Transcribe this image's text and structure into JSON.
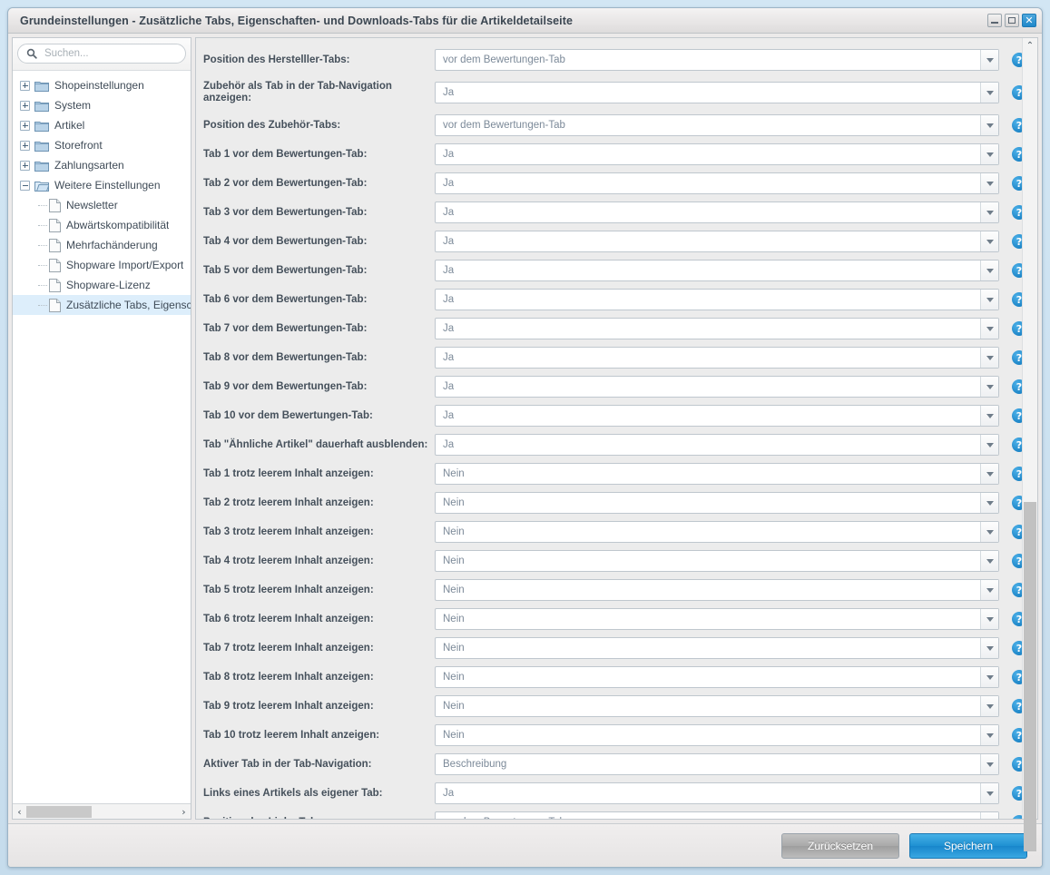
{
  "window": {
    "title": "Grundeinstellungen - Zusätzliche Tabs, Eigenschaften- und Downloads-Tabs für die Artikeldetailseite",
    "minimize_label": "",
    "maximize_label": "",
    "close_label": "✕"
  },
  "search": {
    "placeholder": "Suchen...",
    "value": "",
    "icon": "search-icon"
  },
  "tree": {
    "items": [
      {
        "label": "Shopeinstellungen",
        "type": "folder",
        "expanded": false,
        "selected": false,
        "depth": 0
      },
      {
        "label": "System",
        "type": "folder",
        "expanded": false,
        "selected": false,
        "depth": 0
      },
      {
        "label": "Artikel",
        "type": "folder",
        "expanded": false,
        "selected": false,
        "depth": 0
      },
      {
        "label": "Storefront",
        "type": "folder",
        "expanded": false,
        "selected": false,
        "depth": 0
      },
      {
        "label": "Zahlungsarten",
        "type": "folder",
        "expanded": false,
        "selected": false,
        "depth": 0
      },
      {
        "label": "Weitere Einstellungen",
        "type": "folder",
        "expanded": true,
        "selected": false,
        "depth": 0
      },
      {
        "label": "Newsletter",
        "type": "doc",
        "selected": false,
        "depth": 1
      },
      {
        "label": "Abwärtskompatibilität",
        "type": "doc",
        "selected": false,
        "depth": 1
      },
      {
        "label": "Mehrfachänderung",
        "type": "doc",
        "selected": false,
        "depth": 1
      },
      {
        "label": "Shopware Import/Export",
        "type": "doc",
        "selected": false,
        "depth": 1
      },
      {
        "label": "Shopware-Lizenz",
        "type": "doc",
        "selected": false,
        "depth": 1
      },
      {
        "label": "Zusätzliche Tabs, Eigenschaften",
        "type": "doc",
        "selected": true,
        "depth": 1
      }
    ],
    "hscroll": {
      "left_arrow": "‹",
      "right_arrow": "›"
    }
  },
  "form": {
    "help_icon_label": "?",
    "rows": [
      {
        "label": "Position des Herstelller-Tabs:",
        "value": "vor dem Bewertungen-Tab",
        "tall": false
      },
      {
        "label": "Zubehör als Tab in der Tab-Navigation anzeigen:",
        "value": "Ja",
        "tall": true
      },
      {
        "label": "Position des Zubehör-Tabs:",
        "value": "vor dem Bewertungen-Tab",
        "tall": false
      },
      {
        "label": "Tab 1 vor dem Bewertungen-Tab:",
        "value": "Ja",
        "tall": false
      },
      {
        "label": "Tab 2 vor dem Bewertungen-Tab:",
        "value": "Ja",
        "tall": false
      },
      {
        "label": "Tab 3 vor dem Bewertungen-Tab:",
        "value": "Ja",
        "tall": false
      },
      {
        "label": "Tab 4 vor dem Bewertungen-Tab:",
        "value": "Ja",
        "tall": false
      },
      {
        "label": "Tab 5 vor dem Bewertungen-Tab:",
        "value": "Ja",
        "tall": false
      },
      {
        "label": "Tab 6 vor dem Bewertungen-Tab:",
        "value": "Ja",
        "tall": false
      },
      {
        "label": "Tab 7 vor dem Bewertungen-Tab:",
        "value": "Ja",
        "tall": false
      },
      {
        "label": "Tab 8 vor dem Bewertungen-Tab:",
        "value": "Ja",
        "tall": false
      },
      {
        "label": "Tab 9 vor dem Bewertungen-Tab:",
        "value": "Ja",
        "tall": false
      },
      {
        "label": "Tab 10 vor dem Bewertungen-Tab:",
        "value": "Ja",
        "tall": false
      },
      {
        "label": "Tab \"Ähnliche Artikel\" dauerhaft ausblenden:",
        "value": "Ja",
        "tall": false
      },
      {
        "label": "Tab 1 trotz leerem Inhalt anzeigen:",
        "value": "Nein",
        "tall": false
      },
      {
        "label": "Tab 2 trotz leerem Inhalt anzeigen:",
        "value": "Nein",
        "tall": false
      },
      {
        "label": "Tab 3 trotz leerem Inhalt anzeigen:",
        "value": "Nein",
        "tall": false
      },
      {
        "label": "Tab 4 trotz leerem Inhalt anzeigen:",
        "value": "Nein",
        "tall": false
      },
      {
        "label": "Tab 5 trotz leerem Inhalt anzeigen:",
        "value": "Nein",
        "tall": false
      },
      {
        "label": "Tab 6 trotz leerem Inhalt anzeigen:",
        "value": "Nein",
        "tall": false
      },
      {
        "label": "Tab 7 trotz leerem Inhalt anzeigen:",
        "value": "Nein",
        "tall": false
      },
      {
        "label": "Tab 8 trotz leerem Inhalt anzeigen:",
        "value": "Nein",
        "tall": false
      },
      {
        "label": "Tab 9 trotz leerem Inhalt anzeigen:",
        "value": "Nein",
        "tall": false
      },
      {
        "label": "Tab 10 trotz leerem Inhalt anzeigen:",
        "value": "Nein",
        "tall": false
      },
      {
        "label": "Aktiver Tab in der Tab-Navigation:",
        "value": "Beschreibung",
        "tall": false
      },
      {
        "label": "Links eines Artikels als eigener Tab:",
        "value": "Ja",
        "tall": false
      },
      {
        "label": "Position des Links-Tabs:",
        "value": "vor dem Bewertungen-Tab",
        "tall": false
      }
    ],
    "vscroll": {
      "up_arrow": "⌃",
      "down_arrow": "⌄"
    }
  },
  "footer": {
    "reset_label": "Zurücksetzen",
    "save_label": "Speichern"
  },
  "colors": {
    "accent": "#1e90d2",
    "page_bg": "#cfe4f2",
    "label_text": "#45505b",
    "value_text": "#7c8a99",
    "selected_row": "#ddeefb"
  }
}
